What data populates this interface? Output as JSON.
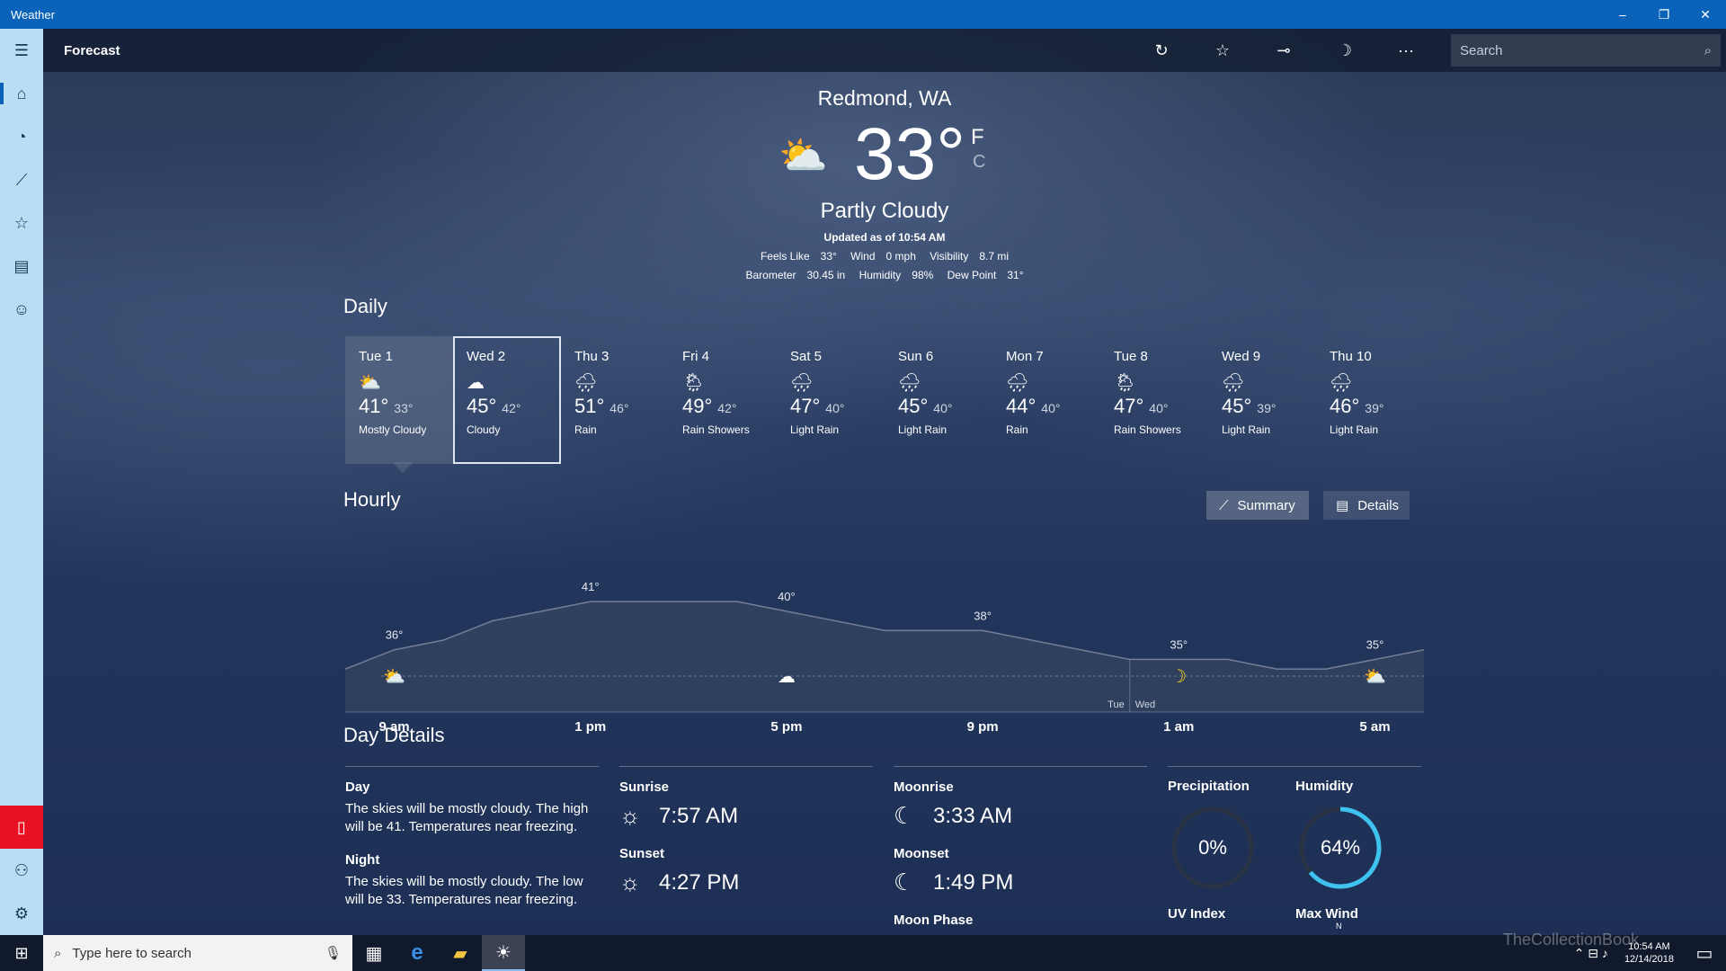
{
  "window": {
    "title": "Weather",
    "minimize": "–",
    "restore": "❐",
    "close": "✕"
  },
  "sidebar": {
    "menu_icon": "☰",
    "items": [
      {
        "name": "home-icon",
        "glyph": "⌂"
      },
      {
        "name": "radar-icon",
        "glyph": "◔"
      },
      {
        "name": "historical-icon",
        "glyph": "⟋"
      },
      {
        "name": "places-icon",
        "glyph": "☆"
      },
      {
        "name": "news-icon",
        "glyph": "▤"
      },
      {
        "name": "feedback-icon",
        "glyph": "☺"
      }
    ],
    "phone_icon": "▯",
    "account_icon": "⚇",
    "settings_icon": "⚙"
  },
  "appbar": {
    "title": "Forecast",
    "refresh": "↻",
    "favorite": "☆",
    "pin": "⊸",
    "theme": "☽",
    "more": "···",
    "search_placeholder": "Search",
    "search_icon": "⌕"
  },
  "current": {
    "location": "Redmond, WA",
    "temp": "33°",
    "icon": "⛅",
    "unit_f": "F",
    "unit_c": "C",
    "condition": "Partly Cloudy",
    "updated": "Updated as of 10:54 AM",
    "details1": [
      {
        "label": "Feels Like",
        "value": "33°"
      },
      {
        "label": "Wind",
        "value": "0 mph"
      },
      {
        "label": "Visibility",
        "value": "8.7 mi"
      }
    ],
    "details2": [
      {
        "label": "Barometer",
        "value": "30.45 in"
      },
      {
        "label": "Humidity",
        "value": "98%"
      },
      {
        "label": "Dew Point",
        "value": "31°"
      }
    ]
  },
  "daily": {
    "title": "Daily",
    "days": [
      {
        "day": "Tue 1",
        "icon": "⛅",
        "hi": "41°",
        "lo": "33°",
        "cond": "Mostly Cloudy"
      },
      {
        "day": "Wed 2",
        "icon": "☁",
        "hi": "45°",
        "lo": "42°",
        "cond": "Cloudy"
      },
      {
        "day": "Thu 3",
        "icon": "🌧",
        "hi": "51°",
        "lo": "46°",
        "cond": "Rain"
      },
      {
        "day": "Fri 4",
        "icon": "🌦",
        "hi": "49°",
        "lo": "42°",
        "cond": "Rain Showers"
      },
      {
        "day": "Sat 5",
        "icon": "🌧",
        "hi": "47°",
        "lo": "40°",
        "cond": "Light Rain"
      },
      {
        "day": "Sun 6",
        "icon": "🌧",
        "hi": "45°",
        "lo": "40°",
        "cond": "Light Rain"
      },
      {
        "day": "Mon 7",
        "icon": "🌧",
        "hi": "44°",
        "lo": "40°",
        "cond": "Rain"
      },
      {
        "day": "Tue 8",
        "icon": "🌦",
        "hi": "47°",
        "lo": "40°",
        "cond": "Rain Showers"
      },
      {
        "day": "Wed 9",
        "icon": "🌧",
        "hi": "45°",
        "lo": "39°",
        "cond": "Light Rain"
      },
      {
        "day": "Thu 10",
        "icon": "🌧",
        "hi": "46°",
        "lo": "39°",
        "cond": "Light Rain"
      }
    ]
  },
  "hourly": {
    "title": "Hourly",
    "summary_label": "Summary",
    "details_label": "Details",
    "summary_icon": "⟋",
    "details_icon": "▤",
    "day_split": {
      "left": "Tue",
      "right": "Wed"
    }
  },
  "chart_data": {
    "type": "area",
    "x": [
      "8 am",
      "9 am",
      "10 am",
      "11 am",
      "12 pm",
      "1 pm",
      "2 pm",
      "3 pm",
      "4 pm",
      "5 pm",
      "6 pm",
      "7 pm",
      "8 pm",
      "9 pm",
      "10 pm",
      "11 pm",
      "12 am",
      "1 am",
      "2 am",
      "3 am",
      "4 am",
      "5 am",
      "6 am"
    ],
    "x_tick_labels": [
      "9 am",
      "1 pm",
      "5 pm",
      "9 pm",
      "1 am",
      "5 am"
    ],
    "temps": [
      34,
      36,
      37,
      39,
      40,
      41,
      41,
      41,
      41,
      40,
      39,
      38,
      38,
      38,
      37,
      36,
      35,
      35,
      35,
      34,
      34,
      35,
      36
    ],
    "temp_labels": [
      {
        "x": "9 am",
        "label": "36°"
      },
      {
        "x": "1 pm",
        "label": "41°"
      },
      {
        "x": "5 pm",
        "label": "40°"
      },
      {
        "x": "9 pm",
        "label": "38°"
      },
      {
        "x": "1 am",
        "label": "35°"
      },
      {
        "x": "5 am",
        "label": "35°"
      }
    ],
    "icons": [
      {
        "x": "9 am",
        "glyph": "⛅",
        "color": "#ffffff"
      },
      {
        "x": "5 pm",
        "glyph": "☁",
        "color": "#ffffff"
      },
      {
        "x": "1 am",
        "glyph": "☽",
        "color": "#f2d21b"
      },
      {
        "x": "5 am",
        "glyph": "⛅",
        "color": "#ffffff"
      }
    ],
    "day_split_x": "12 am"
  },
  "day_details": {
    "title": "Day Details",
    "day_label": "Day",
    "day_text": "The skies will be mostly cloudy. The high will be 41. Temperatures near freezing.",
    "night_label": "Night",
    "night_text": "The skies will be mostly cloudy. The low will be 33. Temperatures near freezing.",
    "sunrise_label": "Sunrise",
    "sunrise": "7:57 AM",
    "sunset_label": "Sunset",
    "sunset": "4:27 PM",
    "sun_icon": "☼",
    "moonrise_label": "Moonrise",
    "moonrise": "3:33 AM",
    "moonset_label": "Moonset",
    "moonset": "1:49 PM",
    "moon_icon": "☾",
    "moon_phase_label": "Moon Phase",
    "precip_label": "Precipitation",
    "precip": "0%",
    "precip_fraction": 0,
    "humidity_label": "Humidity",
    "humidity": "64%",
    "humidity_fraction": 0.64,
    "uv_label": "UV Index",
    "wind_label": "Max Wind",
    "wind_dir": "N",
    "accent": "#3ec3f0"
  },
  "taskbar": {
    "start": "⊞",
    "search_placeholder": "Type here to search",
    "search_icon": "⌕",
    "mic_icon": "🎙",
    "taskview_icon": "▦",
    "edge_icon": "e",
    "explorer_icon": "▰",
    "weather_icon": "☀",
    "tray_icons": "⌃ ⊟ ♪",
    "time": "10:54 AM",
    "date": "12/14/2018",
    "notification_icon": "▭"
  },
  "watermark": "TheCollectionBook"
}
